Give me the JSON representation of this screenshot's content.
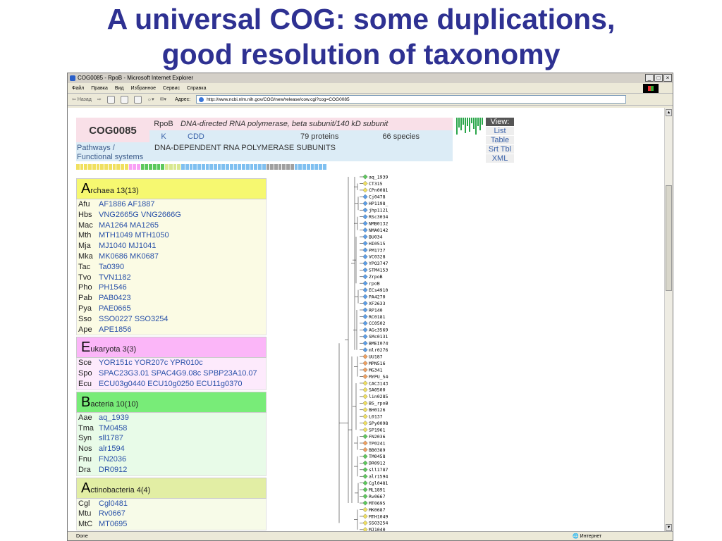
{
  "slide": {
    "title_line1": "A universal COG: some duplications,",
    "title_line2": "good resolution of taxonomy"
  },
  "browser": {
    "window_title": "COG0085 - RpoB - Microsoft Internet Explorer",
    "menu": [
      "Файл",
      "Правка",
      "Вид",
      "Избранное",
      "Сервис",
      "Справка"
    ],
    "back_label": "Назад",
    "address_label": "Адрес:",
    "url": "http://www.ncbi.nlm.nih.gov/COG/new/release/cow.cgi?cog=COG0085",
    "status": "Done",
    "zone": "Интернет"
  },
  "cog": {
    "id": "COG0085",
    "gene": "RpoB",
    "description": "DNA-directed RNA polymerase, beta subunit/140 kD subunit",
    "category": "K",
    "cdd": "CDD",
    "proteins": "79 proteins",
    "species": "66 species",
    "pathways_label": "Pathways /",
    "functional_label": "Functional systems",
    "pathway_value": "DNA-DEPENDENT RNA POLYMERASE SUBUNITS"
  },
  "view": {
    "title": "View:",
    "items": [
      "List",
      "Table",
      "Srt Tbl",
      "XML"
    ]
  },
  "colors": {
    "archaea_head": "#f6f870",
    "archaea_body": "#fbfbe4",
    "eukaryota_head": "#fbb6f8",
    "eukaryota_body": "#fdeafc",
    "bacteria_head": "#78ec78",
    "bacteria_body": "#e8fbe8",
    "actino_head": "#e2eea4",
    "actino_body": "#f7fbe8"
  },
  "groups": [
    {
      "letter": "A",
      "name": "rchaea 13(13)",
      "key": "archaea",
      "rows": [
        {
          "org": "Afu",
          "genes": "AF1886 AF1887"
        },
        {
          "org": "Hbs",
          "genes": "VNG2665G VNG2666G"
        },
        {
          "org": "Mac",
          "genes": "MA1264 MA1265"
        },
        {
          "org": "Mth",
          "genes": "MTH1049 MTH1050"
        },
        {
          "org": "Mja",
          "genes": "MJ1040 MJ1041"
        },
        {
          "org": "Mka",
          "genes": "MK0686 MK0687"
        },
        {
          "org": "Tac",
          "genes": "Ta0390"
        },
        {
          "org": "Tvo",
          "genes": "TVN1182"
        },
        {
          "org": "Pho",
          "genes": "PH1546"
        },
        {
          "org": "Pab",
          "genes": "PAB0423"
        },
        {
          "org": "Pya",
          "genes": "PAE0665"
        },
        {
          "org": "Sso",
          "genes": "SSO0227 SSO3254"
        },
        {
          "org": "Ape",
          "genes": "APE1856"
        }
      ]
    },
    {
      "letter": "E",
      "name": "ukaryota 3(3)",
      "key": "eukaryota",
      "rows": [
        {
          "org": "Sce",
          "genes": "YOR151c YOR207c YPR010c"
        },
        {
          "org": "Spo",
          "genes": "SPAC23G3.01 SPAC4G9.08c SPBP23A10.07"
        },
        {
          "org": "Ecu",
          "genes": "ECU03g0440 ECU10g0250 ECU11g0370"
        }
      ]
    },
    {
      "letter": "B",
      "name": "acteria 10(10)",
      "key": "bacteria",
      "rows": [
        {
          "org": "Aae",
          "genes": "aq_1939"
        },
        {
          "org": "Tma",
          "genes": "TM0458"
        },
        {
          "org": "Syn",
          "genes": "sll1787"
        },
        {
          "org": "Nos",
          "genes": "alr1594"
        },
        {
          "org": "Fnu",
          "genes": "FN2036"
        },
        {
          "org": "Dra",
          "genes": "DR0912"
        }
      ]
    },
    {
      "letter": "A",
      "name": "ctinobacteria 4(4)",
      "key": "actino",
      "rows": [
        {
          "org": "Cgl",
          "genes": "Cgl0481"
        },
        {
          "org": "Mtu",
          "genes": "Rv0667"
        },
        {
          "org": "MtC",
          "genes": "MT0695"
        }
      ]
    }
  ],
  "tree_leaves": [
    {
      "label": "aq_1939",
      "color": "#5cc85c"
    },
    {
      "label": "CT315",
      "color": "#f0e060"
    },
    {
      "label": "CPn0081",
      "color": "#f0e060"
    },
    {
      "label": "Cj0478",
      "color": "#5b9ee8"
    },
    {
      "label": "HP1198_1",
      "color": "#5b9ee8"
    },
    {
      "label": "jhp1121_1",
      "color": "#5b9ee8"
    },
    {
      "label": "RSc3034",
      "color": "#5b9ee8"
    },
    {
      "label": "NMB0132",
      "color": "#5b9ee8"
    },
    {
      "label": "NMA0142",
      "color": "#5b9ee8"
    },
    {
      "label": "BU034",
      "color": "#5b9ee8"
    },
    {
      "label": "HI0515",
      "color": "#5b9ee8"
    },
    {
      "label": "PM1737",
      "color": "#5b9ee8"
    },
    {
      "label": "VC0328",
      "color": "#5b9ee8"
    },
    {
      "label": "YPO3747",
      "color": "#5b9ee8"
    },
    {
      "label": "STM4153",
      "color": "#5b9ee8"
    },
    {
      "label": "ZrpoB",
      "color": "#5b9ee8"
    },
    {
      "label": "rpoB",
      "color": "#5b9ee8"
    },
    {
      "label": "ECs4910",
      "color": "#5b9ee8"
    },
    {
      "label": "PA4270",
      "color": "#5b9ee8"
    },
    {
      "label": "XF2633",
      "color": "#5b9ee8"
    },
    {
      "label": "RP140",
      "color": "#5b9ee8"
    },
    {
      "label": "RC0181",
      "color": "#5b9ee8"
    },
    {
      "label": "CC0502",
      "color": "#5b9ee8"
    },
    {
      "label": "AGc3569",
      "color": "#5b9ee8"
    },
    {
      "label": "SMc01317",
      "color": "#5b9ee8"
    },
    {
      "label": "BMEI0749",
      "color": "#5b9ee8"
    },
    {
      "label": "mlr0276",
      "color": "#5b9ee8"
    },
    {
      "label": "UU187",
      "color": "#f0a060"
    },
    {
      "label": "MPN516",
      "color": "#f0a060"
    },
    {
      "label": "MG341",
      "color": "#f0a060"
    },
    {
      "label": "MYPU_5460",
      "color": "#f0a060"
    },
    {
      "label": "CAC3143",
      "color": "#f0e060"
    },
    {
      "label": "SA0500",
      "color": "#f0e060"
    },
    {
      "label": "lin0285",
      "color": "#f0e060"
    },
    {
      "label": "BS_rpoB",
      "color": "#f0e060"
    },
    {
      "label": "BH0126",
      "color": "#f0e060"
    },
    {
      "label": "L0137",
      "color": "#f0e060"
    },
    {
      "label": "SPy0098",
      "color": "#f0e060"
    },
    {
      "label": "SP1961",
      "color": "#f0e060"
    },
    {
      "label": "FN2036",
      "color": "#5cc85c"
    },
    {
      "label": "TP0241",
      "color": "#f0a060"
    },
    {
      "label": "BB0389",
      "color": "#f0a060"
    },
    {
      "label": "TM0458",
      "color": "#5cc85c"
    },
    {
      "label": "DR0912",
      "color": "#5cc85c"
    },
    {
      "label": "sll1787",
      "color": "#5cc85c"
    },
    {
      "label": "alr1594",
      "color": "#5cc85c"
    },
    {
      "label": "Cgl0481",
      "color": "#5cc85c"
    },
    {
      "label": "ML1891",
      "color": "#5cc85c"
    },
    {
      "label": "Rv0667",
      "color": "#5cc85c"
    },
    {
      "label": "MT0695",
      "color": "#5cc85c"
    },
    {
      "label": "MK0687",
      "color": "#f0e060"
    },
    {
      "label": "MTH1049",
      "color": "#f0e060"
    },
    {
      "label": "SSO3254",
      "color": "#f0e060"
    },
    {
      "label": "MJ1040",
      "color": "#f0e060"
    }
  ],
  "strip_colors": [
    "#f0e060",
    "#f0e060",
    "#f0e060",
    "#f0e060",
    "#f0e060",
    "#f0e060",
    "#f0e060",
    "#f0e060",
    "#f0e060",
    "#f0e060",
    "#f0e060",
    "#f0e060",
    "#f0e060",
    "#f9a0f5",
    "#f9a0f5",
    "#f9a0f5",
    "#5cc85c",
    "#5cc85c",
    "#5cc85c",
    "#5cc85c",
    "#5cc85c",
    "#5cc85c",
    "#d8e890",
    "#d8e890",
    "#d8e890",
    "#d8e890",
    "#80c0f0",
    "#80c0f0",
    "#80c0f0",
    "#80c0f0",
    "#80c0f0",
    "#80c0f0",
    "#80c0f0",
    "#80c0f0",
    "#80c0f0",
    "#80c0f0",
    "#80c0f0",
    "#80c0f0",
    "#80c0f0",
    "#80c0f0",
    "#80c0f0",
    "#80c0f0",
    "#80c0f0",
    "#80c0f0",
    "#80c0f0",
    "#80c0f0",
    "#80c0f0",
    "#a0a0a0",
    "#a0a0a0",
    "#a0a0a0",
    "#a0a0a0",
    "#a0a0a0",
    "#a0a0a0",
    "#a0a0a0",
    "#80c0f0",
    "#80c0f0",
    "#80c0f0",
    "#80c0f0",
    "#80c0f0",
    "#80c0f0",
    "#80c0f0",
    "#80c0f0"
  ]
}
